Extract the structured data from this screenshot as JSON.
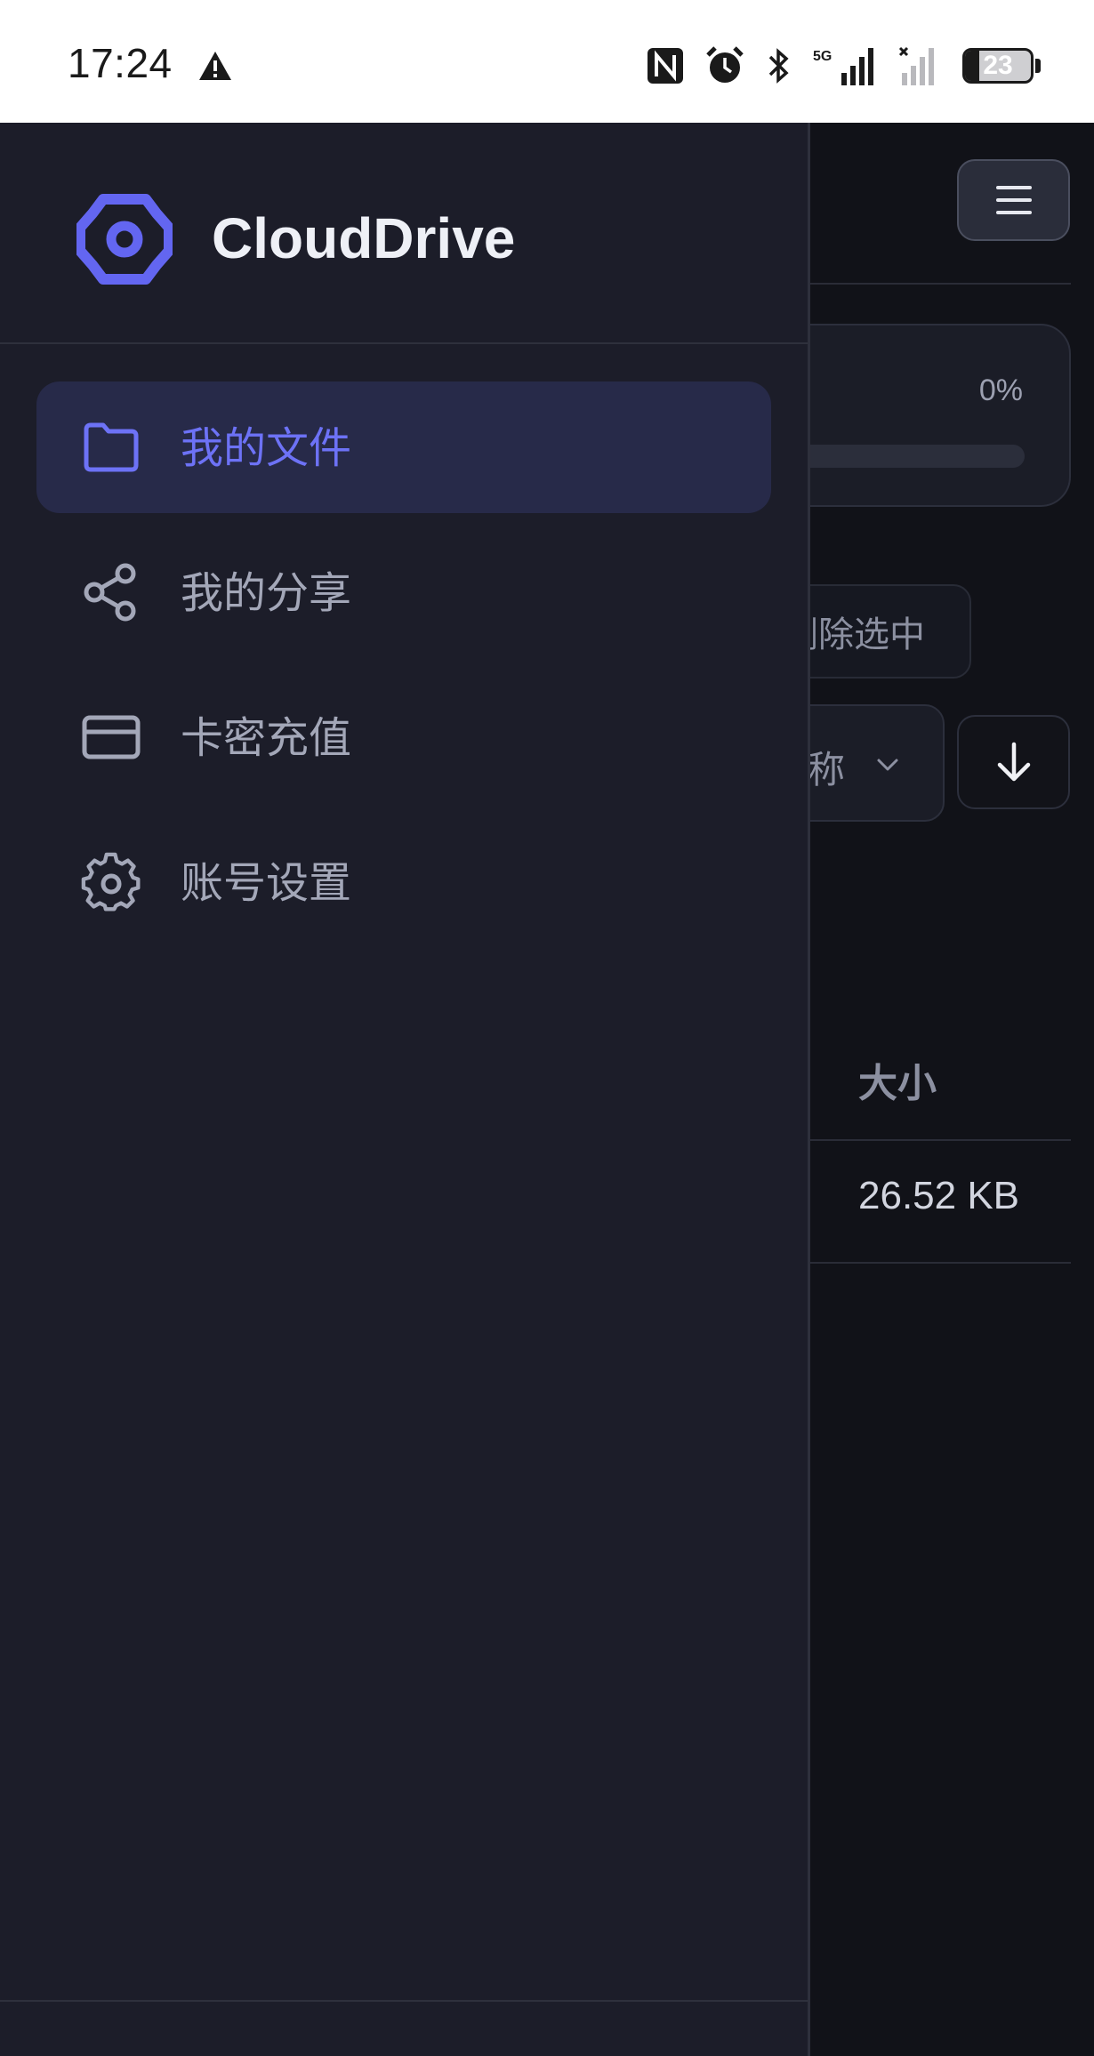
{
  "status_bar": {
    "time": "17:24",
    "icons": [
      "warning-icon",
      "nfc-icon",
      "alarm-icon",
      "bluetooth-icon",
      "signal-5g-icon",
      "signal-no-service-icon",
      "battery-icon"
    ],
    "network_label": "5G",
    "battery_level": "23"
  },
  "app": {
    "storage": {
      "percent_label": "0%",
      "used_fraction": 0
    },
    "toolbar": {
      "delete_selected_label": "删除选中"
    },
    "sort": {
      "field_label_visible": "称"
    },
    "table": {
      "header_size": "大小",
      "rows": [
        {
          "size": "26.52 KB"
        }
      ]
    }
  },
  "drawer": {
    "brand": "CloudDrive",
    "items": [
      {
        "label": "我的文件",
        "icon": "folder-icon",
        "active": true
      },
      {
        "label": "我的分享",
        "icon": "share-icon",
        "active": false
      },
      {
        "label": "卡密充值",
        "icon": "credit-card-icon",
        "active": false
      },
      {
        "label": "账号设置",
        "icon": "gear-icon",
        "active": false
      }
    ]
  },
  "colors": {
    "accent": "#6366f1",
    "drawer_bg": "#1c1d29",
    "page_bg": "#111218"
  }
}
